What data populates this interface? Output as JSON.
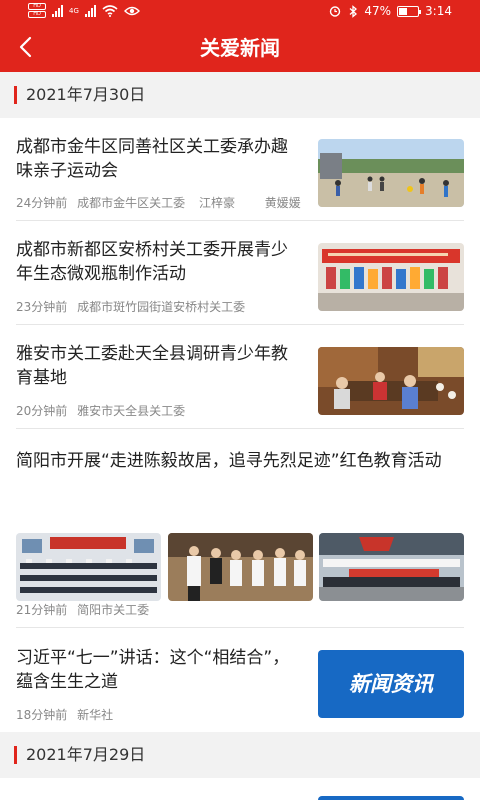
{
  "status": {
    "sim1": "HD",
    "sim2": "HD",
    "network": "4G",
    "battery": "47%",
    "battery_level": 0.47,
    "time": "3:14"
  },
  "header": {
    "title": "关爱新闻"
  },
  "sections": [
    {
      "date": "2021年7月30日"
    },
    {
      "date": "2021年7月29日"
    }
  ],
  "articles": [
    {
      "headline": "成都市金牛区同善社区关工委承办趣味亲子运动会",
      "time": "24分钟前",
      "source": "成都市金牛区关工委",
      "author1": "江梓豪",
      "author2": "黄媛媛"
    },
    {
      "headline": "成都市新都区安桥村关工委开展青少年生态微观瓶制作活动",
      "time": "23分钟前",
      "source": "成都市斑竹园街道安桥村关工委"
    },
    {
      "headline": "雅安市关工委赴天全县调研青少年教育基地",
      "time": "20分钟前",
      "source": "雅安市天全县关工委"
    },
    {
      "headline": "简阳市开展“走进陈毅故居，追寻先烈足迹”红色教育活动",
      "time": "21分钟前",
      "source": "简阳市关工委"
    },
    {
      "headline": "习近平“七一”讲话：这个“相结合”，蕴含生生之道",
      "time": "18分钟前",
      "source": "新华社",
      "thumb_text": "新闻资讯"
    }
  ]
}
